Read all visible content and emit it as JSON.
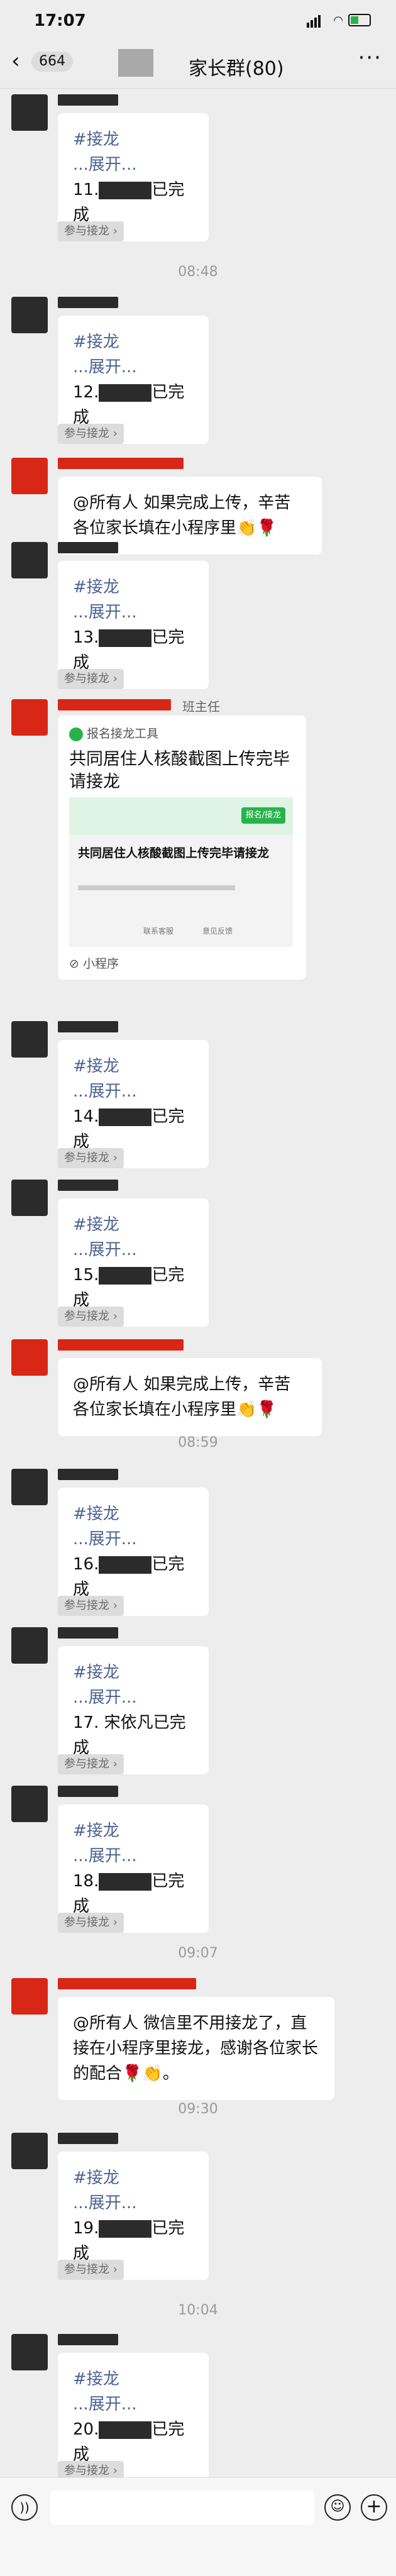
{
  "status": {
    "time": "17:07"
  },
  "nav": {
    "back_count": "664",
    "title": "家长群(80)",
    "more": "···"
  },
  "labels": {
    "join": "参与接龙 ›",
    "hash": "#接龙",
    "expand": "...展开...",
    "done": "已完成",
    "owner": "班主任"
  },
  "times": [
    "08:48",
    "08:59",
    "09:07",
    "09:30",
    "10:04"
  ],
  "notices": {
    "upload": "@所有人 如果完成上传，辛苦各位家长填在小程序里👏🌹",
    "final": "@所有人 微信里不用接龙了，直接在小程序里接龙，感谢各位家长的配合🌹👏。"
  },
  "mini": {
    "app": "报名接龙工具",
    "title": "共同居住人核酸截图上传完毕请接龙",
    "card_title": "共同居住人核酸截图上传完毕请接龙",
    "card_btn": "报名/接龙",
    "link1": "联系客服",
    "link2": "意见反馈",
    "footer": "小程序"
  },
  "entries": [
    {
      "num": "11.",
      "name": ""
    },
    {
      "num": "12.",
      "name": ""
    },
    {
      "num": "13.",
      "name": ""
    },
    {
      "num": "14.",
      "name": ""
    },
    {
      "num": "15.",
      "name": ""
    },
    {
      "num": "16.",
      "name": ""
    },
    {
      "num": "17.",
      "name": "宋依凡"
    },
    {
      "num": "18.",
      "name": ""
    },
    {
      "num": "19.",
      "name": ""
    },
    {
      "num": "20.",
      "name": ""
    }
  ]
}
